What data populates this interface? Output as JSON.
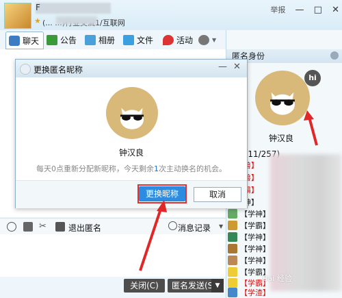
{
  "window": {
    "title_name_visible": "F",
    "title_desc": "(... ...)行业交流1/互联网",
    "report_label": "举报",
    "controls": [
      "—",
      "□",
      "✕"
    ]
  },
  "toolbar": {
    "tabs": [
      {
        "label": "聊天",
        "icon": "chat-icon",
        "color": "#3c7cc2"
      },
      {
        "label": "公告",
        "icon": "flag-icon",
        "color": "#3a9a3a"
      },
      {
        "label": "相册",
        "icon": "photo-icon",
        "color": "#4aa0d8"
      },
      {
        "label": "文件",
        "icon": "folder-icon",
        "color": "#3aa0e0"
      },
      {
        "label": "活动",
        "icon": "pin-icon",
        "color": "#d33"
      },
      {
        "label": "",
        "icon": "gear-icon",
        "color": "#777"
      }
    ]
  },
  "right_panel": {
    "header": "匿名身份",
    "profile_name": "钟汉良",
    "hi_badge": "hi",
    "members_header": "员(111/257)",
    "members": [
      {
        "badge": "【叫兽】",
        "color": "#d11"
      },
      {
        "badge": "【叫兽】",
        "color": "#d11"
      },
      {
        "badge": "【学霸】",
        "color": "#d11"
      },
      {
        "badge": "【学神】",
        "color": "#222"
      },
      {
        "badge": "【学神】",
        "color": "#222"
      },
      {
        "badge": "【学霸】",
        "color": "#222"
      },
      {
        "badge": "【学神】",
        "color": "#222"
      },
      {
        "badge": "【学神】",
        "color": "#222"
      },
      {
        "badge": "【学神】",
        "color": "#222"
      },
      {
        "badge": "【学霸】",
        "color": "#222"
      },
      {
        "badge": "【学霸】",
        "color": "#d11"
      },
      {
        "badge": "【学霸】",
        "color": "#222"
      },
      {
        "badge": "【学渣】",
        "color": "#d11"
      }
    ]
  },
  "input_tools": {
    "exit_anon": "退出匿名",
    "history": "消息记录"
  },
  "buttons": {
    "close": "关闭(C)",
    "send": "匿名发送(S)",
    "send_arrow": "▼"
  },
  "dialog": {
    "title": "更换匿名昵称",
    "name": "钟汉良",
    "note_before": "每天0点重新分配新昵称，今天剩余",
    "note_count": "1",
    "note_after": "次主动换名的机会。",
    "change_button": "更换昵称",
    "cancel_button": "取消",
    "min": "—",
    "close": "✕"
  },
  "watermark": "Bai 经验"
}
